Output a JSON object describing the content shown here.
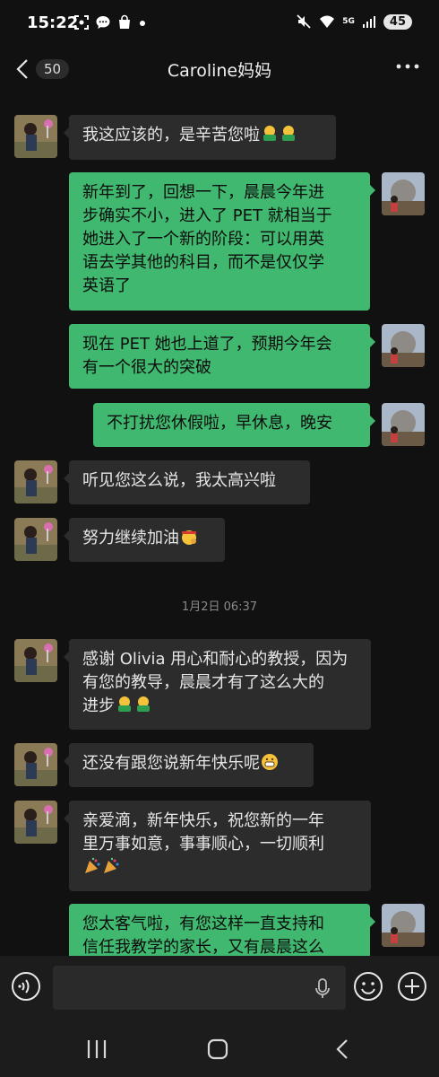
{
  "status_bar": {
    "time": "15:22",
    "network": "5G",
    "battery": "45"
  },
  "header": {
    "unread_count": "50",
    "title": "Caroline妈妈"
  },
  "messages": [
    {
      "side": "in",
      "text": "我这应该的，是辛苦您啦",
      "emoji": [
        "hug",
        "hug"
      ]
    },
    {
      "side": "out",
      "text": "新年到了，回想一下，晨晨今年进步确实不小，进入了 PET 就相当于她进入了一个新的阶段：可以用英语去学其他的科目，而不是仅仅学英语了",
      "emoji": []
    },
    {
      "side": "out",
      "text": "现在 PET 她也上道了，预期今年会有一个很大的突破",
      "emoji": []
    },
    {
      "side": "out",
      "text": "不打扰您休假啦，早休息，晚安",
      "emoji": []
    },
    {
      "side": "in",
      "text": "听见您这么说，我太高兴啦",
      "emoji": []
    },
    {
      "side": "in",
      "text": "努力继续加油",
      "emoji": [
        "fighting"
      ]
    },
    {
      "timestamp": "1月2日 06:37"
    },
    {
      "side": "in",
      "text": "感谢 Olivia 用心和耐心的教授，因为有您的教导，晨晨才有了这么大的进步",
      "emoji": [
        "hug",
        "hug"
      ]
    },
    {
      "side": "in",
      "text": "还没有跟您说新年快乐呢",
      "emoji": [
        "grin"
      ]
    },
    {
      "side": "in",
      "text": "亲爱滴，新年快乐，祝您新的一年里万事如意，事事顺心，一切顺利",
      "emoji": [
        "party",
        "party"
      ]
    },
    {
      "side": "out",
      "text": "您太客气啦，有您这样一直支持和信任我教学的家长，又有晨晨这么",
      "emoji": []
    }
  ],
  "lines": {
    "m0": [
      "我这应该的，是辛苦您啦"
    ],
    "m1": [
      "新年到了，回想一下，晨晨今年进",
      "步确实不小，进入了 PET 就相当于",
      "她进入了一个新的阶段：可以用英",
      "语去学其他的科目，而不是仅仅学",
      "英语了"
    ],
    "m2": [
      "现在 PET 她也上道了，预期今年会",
      "有一个很大的突破"
    ],
    "m3": [
      "不打扰您休假啦，早休息，晚安"
    ],
    "m4": [
      "听见您这么说，我太高兴啦"
    ],
    "m5": [
      "努力继续加油"
    ],
    "m7": [
      "感谢 Olivia 用心和耐心的教授，因为",
      "有您的教导，晨晨才有了这么大的",
      "进步"
    ],
    "m8": [
      "还没有跟您说新年快乐呢"
    ],
    "m9": [
      "亲爱滴，新年快乐，祝您新的一年",
      "里万事如意，事事顺心，一切顺利",
      ""
    ],
    "m10": [
      "您太客气啦，有您这样一直支持和",
      "信任我教学的家长，又有晨晨这么"
    ]
  },
  "input": {
    "placeholder": ""
  },
  "colors": {
    "bg": "#111111",
    "bubble_in": "#2c2c2c",
    "bubble_out": "#41b86f",
    "bars": "#1c1c1c"
  },
  "icons": [
    "back-arrow-icon",
    "more-icon",
    "voice-icon",
    "mic-icon",
    "emoji-icon",
    "plus-icon",
    "recents-icon",
    "home-icon",
    "back-icon"
  ]
}
